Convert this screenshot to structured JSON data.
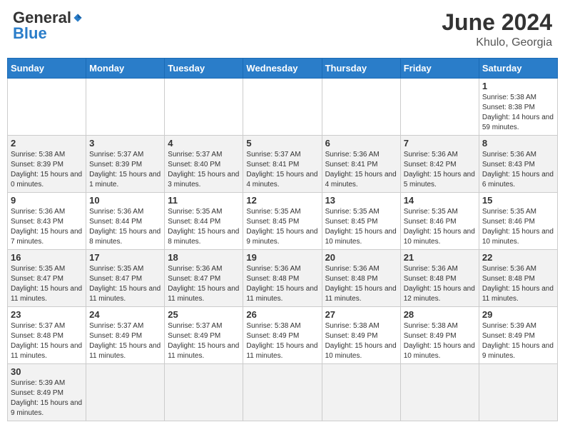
{
  "header": {
    "logo_general": "General",
    "logo_blue": "Blue",
    "month_year": "June 2024",
    "location": "Khulo, Georgia"
  },
  "weekdays": [
    "Sunday",
    "Monday",
    "Tuesday",
    "Wednesday",
    "Thursday",
    "Friday",
    "Saturday"
  ],
  "days": [
    {
      "date": "",
      "info": ""
    },
    {
      "date": "",
      "info": ""
    },
    {
      "date": "",
      "info": ""
    },
    {
      "date": "",
      "info": ""
    },
    {
      "date": "",
      "info": ""
    },
    {
      "date": "",
      "info": ""
    },
    {
      "date": "1",
      "info": "Sunrise: 5:38 AM\nSunset: 8:38 PM\nDaylight: 14 hours and 59 minutes."
    },
    {
      "date": "2",
      "info": "Sunrise: 5:38 AM\nSunset: 8:39 PM\nDaylight: 15 hours and 0 minutes."
    },
    {
      "date": "3",
      "info": "Sunrise: 5:37 AM\nSunset: 8:39 PM\nDaylight: 15 hours and 1 minute."
    },
    {
      "date": "4",
      "info": "Sunrise: 5:37 AM\nSunset: 8:40 PM\nDaylight: 15 hours and 3 minutes."
    },
    {
      "date": "5",
      "info": "Sunrise: 5:37 AM\nSunset: 8:41 PM\nDaylight: 15 hours and 4 minutes."
    },
    {
      "date": "6",
      "info": "Sunrise: 5:36 AM\nSunset: 8:41 PM\nDaylight: 15 hours and 4 minutes."
    },
    {
      "date": "7",
      "info": "Sunrise: 5:36 AM\nSunset: 8:42 PM\nDaylight: 15 hours and 5 minutes."
    },
    {
      "date": "8",
      "info": "Sunrise: 5:36 AM\nSunset: 8:43 PM\nDaylight: 15 hours and 6 minutes."
    },
    {
      "date": "9",
      "info": "Sunrise: 5:36 AM\nSunset: 8:43 PM\nDaylight: 15 hours and 7 minutes."
    },
    {
      "date": "10",
      "info": "Sunrise: 5:36 AM\nSunset: 8:44 PM\nDaylight: 15 hours and 8 minutes."
    },
    {
      "date": "11",
      "info": "Sunrise: 5:35 AM\nSunset: 8:44 PM\nDaylight: 15 hours and 8 minutes."
    },
    {
      "date": "12",
      "info": "Sunrise: 5:35 AM\nSunset: 8:45 PM\nDaylight: 15 hours and 9 minutes."
    },
    {
      "date": "13",
      "info": "Sunrise: 5:35 AM\nSunset: 8:45 PM\nDaylight: 15 hours and 10 minutes."
    },
    {
      "date": "14",
      "info": "Sunrise: 5:35 AM\nSunset: 8:46 PM\nDaylight: 15 hours and 10 minutes."
    },
    {
      "date": "15",
      "info": "Sunrise: 5:35 AM\nSunset: 8:46 PM\nDaylight: 15 hours and 10 minutes."
    },
    {
      "date": "16",
      "info": "Sunrise: 5:35 AM\nSunset: 8:47 PM\nDaylight: 15 hours and 11 minutes."
    },
    {
      "date": "17",
      "info": "Sunrise: 5:35 AM\nSunset: 8:47 PM\nDaylight: 15 hours and 11 minutes."
    },
    {
      "date": "18",
      "info": "Sunrise: 5:36 AM\nSunset: 8:47 PM\nDaylight: 15 hours and 11 minutes."
    },
    {
      "date": "19",
      "info": "Sunrise: 5:36 AM\nSunset: 8:48 PM\nDaylight: 15 hours and 11 minutes."
    },
    {
      "date": "20",
      "info": "Sunrise: 5:36 AM\nSunset: 8:48 PM\nDaylight: 15 hours and 11 minutes."
    },
    {
      "date": "21",
      "info": "Sunrise: 5:36 AM\nSunset: 8:48 PM\nDaylight: 15 hours and 12 minutes."
    },
    {
      "date": "22",
      "info": "Sunrise: 5:36 AM\nSunset: 8:48 PM\nDaylight: 15 hours and 11 minutes."
    },
    {
      "date": "23",
      "info": "Sunrise: 5:37 AM\nSunset: 8:48 PM\nDaylight: 15 hours and 11 minutes."
    },
    {
      "date": "24",
      "info": "Sunrise: 5:37 AM\nSunset: 8:49 PM\nDaylight: 15 hours and 11 minutes."
    },
    {
      "date": "25",
      "info": "Sunrise: 5:37 AM\nSunset: 8:49 PM\nDaylight: 15 hours and 11 minutes."
    },
    {
      "date": "26",
      "info": "Sunrise: 5:38 AM\nSunset: 8:49 PM\nDaylight: 15 hours and 11 minutes."
    },
    {
      "date": "27",
      "info": "Sunrise: 5:38 AM\nSunset: 8:49 PM\nDaylight: 15 hours and 10 minutes."
    },
    {
      "date": "28",
      "info": "Sunrise: 5:38 AM\nSunset: 8:49 PM\nDaylight: 15 hours and 10 minutes."
    },
    {
      "date": "29",
      "info": "Sunrise: 5:39 AM\nSunset: 8:49 PM\nDaylight: 15 hours and 9 minutes."
    },
    {
      "date": "30",
      "info": "Sunrise: 5:39 AM\nSunset: 8:49 PM\nDaylight: 15 hours and 9 minutes."
    },
    {
      "date": "",
      "info": ""
    },
    {
      "date": "",
      "info": ""
    },
    {
      "date": "",
      "info": ""
    },
    {
      "date": "",
      "info": ""
    },
    {
      "date": "",
      "info": ""
    },
    {
      "date": "",
      "info": ""
    }
  ]
}
